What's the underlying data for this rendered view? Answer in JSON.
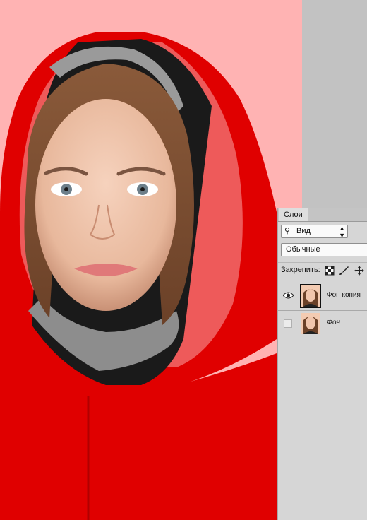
{
  "canvas": {
    "background": "#ffb3b3",
    "hood_color": "#e00000"
  },
  "layers_panel": {
    "tab_label": "Слои",
    "kind_filter": {
      "icon": "search-icon",
      "label": "Вид",
      "arrow": "⇕"
    },
    "blend_mode": "Обычные",
    "lock_label": "Закрепить:",
    "lock_icons": [
      "lock-transparent-pixels-icon",
      "lock-image-pixels-icon",
      "lock-position-icon"
    ],
    "layers": [
      {
        "name": "Фон копия",
        "visible": true,
        "selected": true
      },
      {
        "name": "Фон",
        "visible": false,
        "selected": false
      }
    ]
  }
}
